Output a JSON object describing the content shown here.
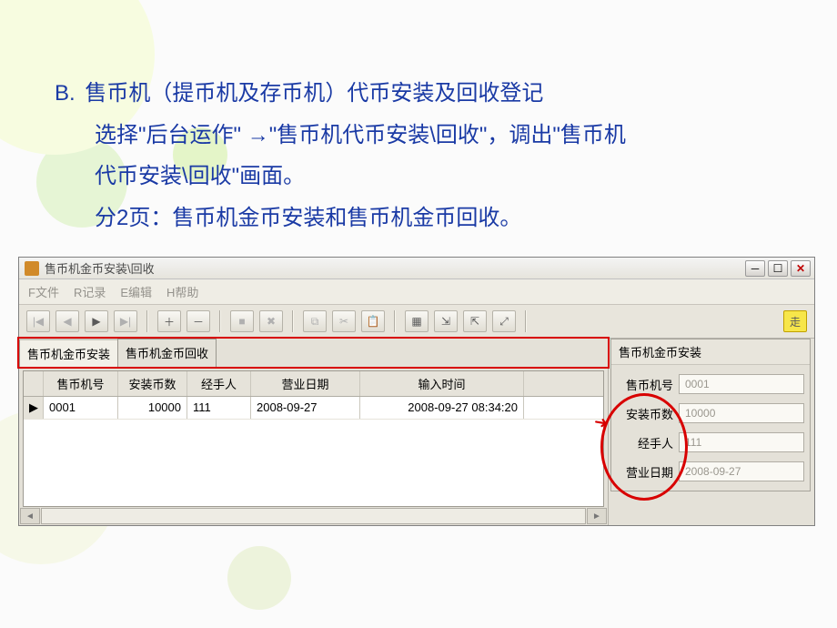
{
  "slide": {
    "b_label": "B.",
    "line1": "售币机（提币机及存币机）代币安装及回收登记",
    "line2": "选择\"后台运作\" →\"售币机代币安装\\回收\"，调出\"售币机",
    "line3": "代币安装\\回收\"画面。",
    "line4": "分2页：售币机金币安装和售币机金币回收。"
  },
  "window": {
    "title": "售币机金币安装\\回收"
  },
  "menu": {
    "file": "F文件",
    "record": "R记录",
    "edit": "E编辑",
    "help": "H帮助"
  },
  "tabs": {
    "install": "售币机金币安装",
    "recover": "售币机金币回收"
  },
  "grid": {
    "headers": {
      "machine": "售币机号",
      "count": "安装币数",
      "handler": "经手人",
      "bizdate": "营业日期",
      "input": "输入时间"
    },
    "rows": [
      {
        "machine": "0001",
        "count": "10000",
        "handler": "111",
        "bizdate": "2008-09-27",
        "input": "2008-09-27 08:34:20"
      }
    ]
  },
  "panel": {
    "title": "售币机金币安装",
    "fields": {
      "machine": {
        "label": "售币机号",
        "value": "0001"
      },
      "count": {
        "label": "安装币数",
        "value": "10000"
      },
      "handler": {
        "label": "经手人",
        "value": "111"
      },
      "bizdate": {
        "label": "营业日期",
        "value": "2008-09-27"
      }
    }
  },
  "icons": {
    "first": "|◀",
    "prev": "◀",
    "next": "▶",
    "last": "▶|",
    "plus": "＋",
    "minus": "－",
    "stop": "■",
    "cancel": "✖",
    "copy": "⧉",
    "cut": "✂",
    "paste": "📋",
    "form": "▦",
    "export": "⇲",
    "import": "⇱",
    "expand": "⤢",
    "run": "走"
  }
}
